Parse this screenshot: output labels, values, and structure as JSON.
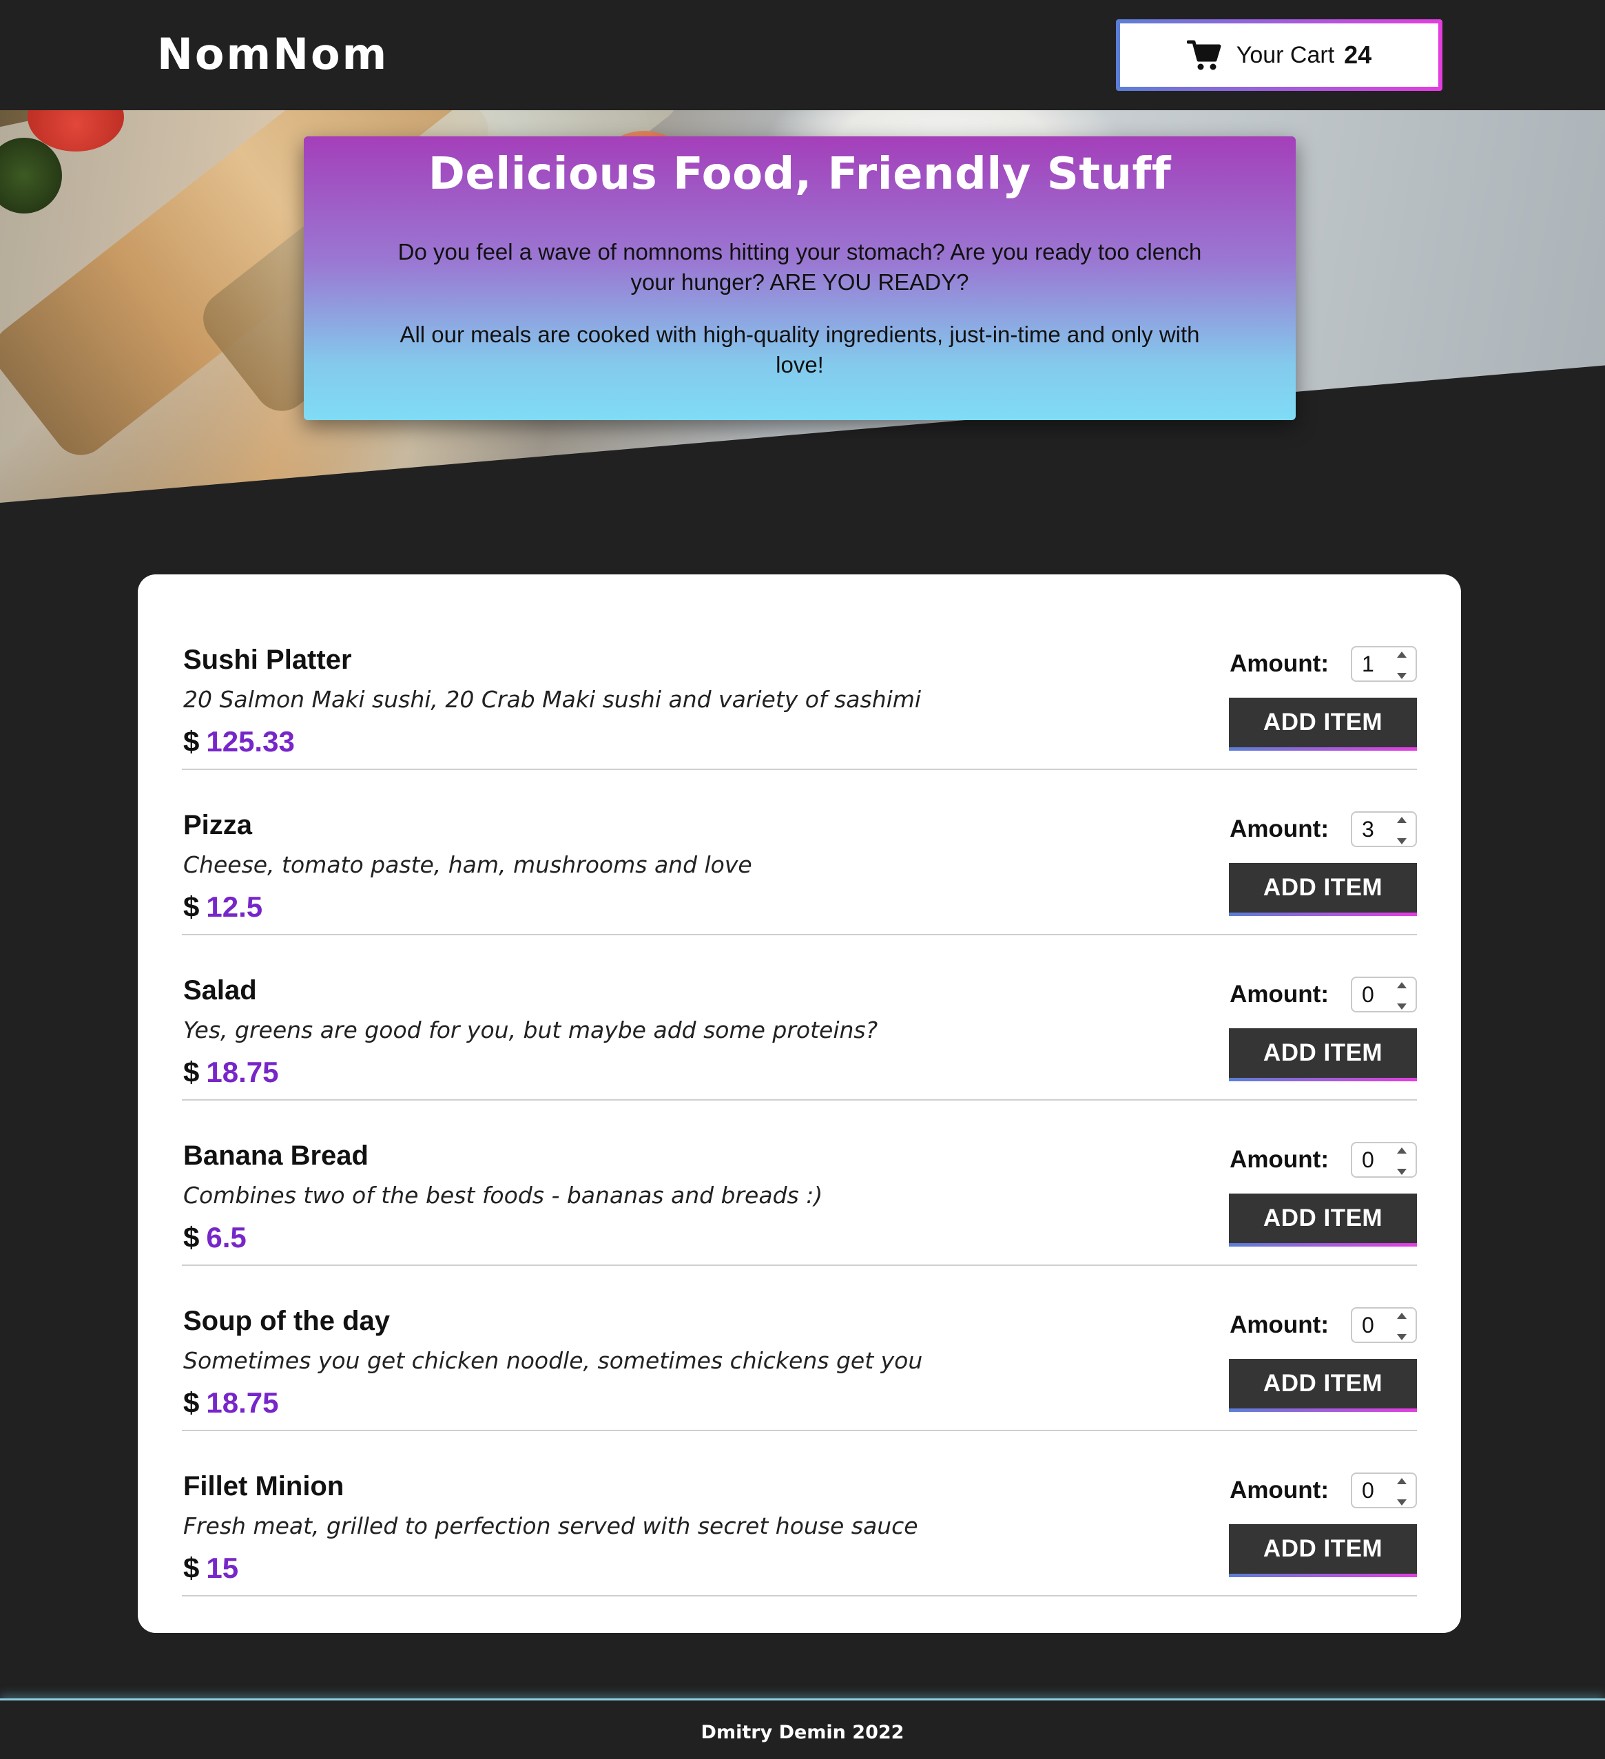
{
  "header": {
    "logo": "NomNom",
    "cart": {
      "icon": "shopping-cart-icon",
      "label": "Your Cart",
      "count": "24",
      "border_gradient": [
        "#5b7fd6",
        "#e43de0"
      ]
    }
  },
  "hero": {
    "title": "Delicious Food, Friendly Stuff",
    "paragraphs": [
      "Do you feel a wave of nomnoms hitting your stomach? Are you ready too clench your hunger? ARE YOU READY?",
      "All our meals are cooked with high-quality ingredients, just-in-time and only with love!"
    ],
    "gradient": [
      "#a43fba",
      "#7fdcf6"
    ]
  },
  "menu": {
    "amount_label": "Amount:",
    "add_button_label": "ADD ITEM",
    "currency": "$",
    "price_color": "#7726c9",
    "items": [
      {
        "name": "Sushi Platter",
        "description": "20 Salmon Maki sushi, 20 Crab Maki sushi and variety of sashimi",
        "price": "125.33",
        "amount": "1"
      },
      {
        "name": "Pizza",
        "description": "Cheese, tomato paste, ham, mushrooms and love",
        "price": "12.5",
        "amount": "3"
      },
      {
        "name": "Salad",
        "description": "Yes, greens are good for you, but maybe add some proteins?",
        "price": "18.75",
        "amount": "0"
      },
      {
        "name": "Banana Bread",
        "description": "Combines two of the best foods - bananas and breads :)",
        "price": "6.5",
        "amount": "0"
      },
      {
        "name": "Soup of the day",
        "description": "Sometimes you get chicken noodle, sometimes chickens get you",
        "price": "18.75",
        "amount": "0"
      },
      {
        "name": "Fillet Minion",
        "description": "Fresh meat, grilled to perfection served with secret house sauce",
        "price": "15",
        "amount": "0"
      }
    ]
  },
  "footer": {
    "text": "Dmitry Demin 2022"
  }
}
